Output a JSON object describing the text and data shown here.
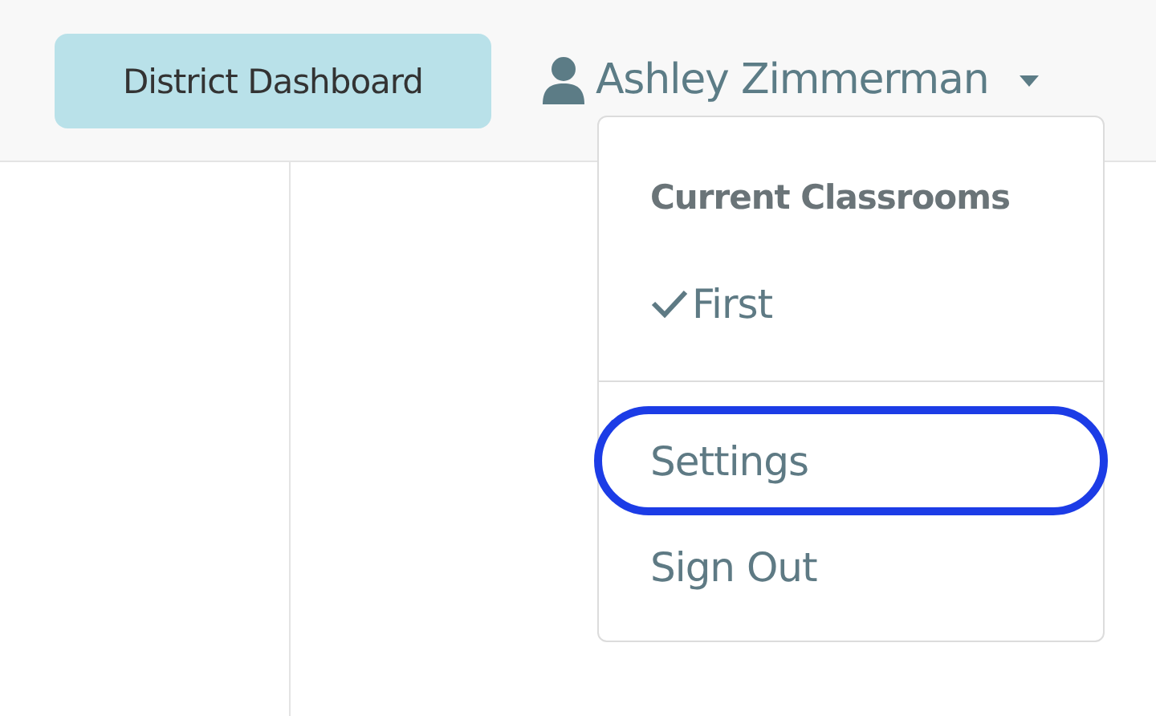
{
  "header": {
    "dashboard_button": "District Dashboard",
    "user_menu": {
      "name": "Ashley Zimmerman",
      "expanded": true
    }
  },
  "dropdown": {
    "sections": [
      {
        "heading": "Current Classrooms",
        "items": [
          {
            "label": "First",
            "checked": true,
            "circled": false
          }
        ]
      },
      {
        "items": [
          {
            "label": "Settings",
            "checked": false,
            "circled": true
          },
          {
            "label": "Sign Out",
            "checked": false,
            "circled": false
          }
        ]
      }
    ]
  }
}
